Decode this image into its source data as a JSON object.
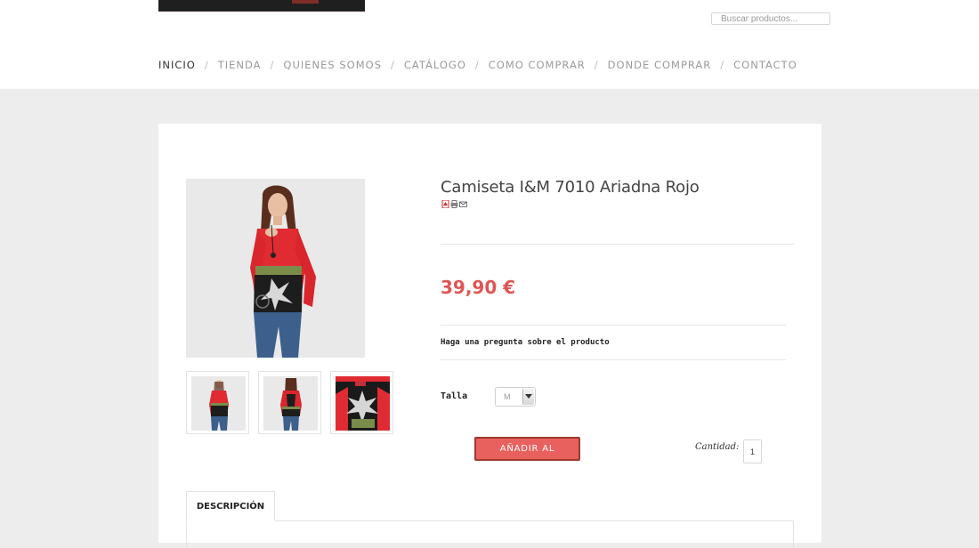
{
  "header": {
    "search_placeholder": "Buscar productos...",
    "nav": [
      {
        "label": "INICIO",
        "active": true
      },
      {
        "label": "TIENDA"
      },
      {
        "label": "QUIENES SOMOS"
      },
      {
        "label": "CATÁLOGO"
      },
      {
        "label": "COMO COMPRAR"
      },
      {
        "label": "DONDE COMPRAR"
      },
      {
        "label": "CONTACTO"
      }
    ],
    "nav_separator": "/"
  },
  "product": {
    "title": "Camiseta I&M 7010 Ariadna Rojo",
    "tool_icons": [
      "pdf-icon",
      "print-icon",
      "email-icon"
    ],
    "price": "39,90 €",
    "ask_question": "Haga una pregunta sobre el producto",
    "size_label": "Talla",
    "size_value": "M",
    "add_to_cart": "AÑADIR AL CARRITO",
    "quantity_label": "Cantidad:",
    "quantity_value": "1"
  },
  "tabs": [
    {
      "label": "DESCRIPCIÓN"
    }
  ],
  "colors": {
    "price": "#e05555",
    "cart_button": "#e9615e",
    "page_background": "#ededed"
  }
}
